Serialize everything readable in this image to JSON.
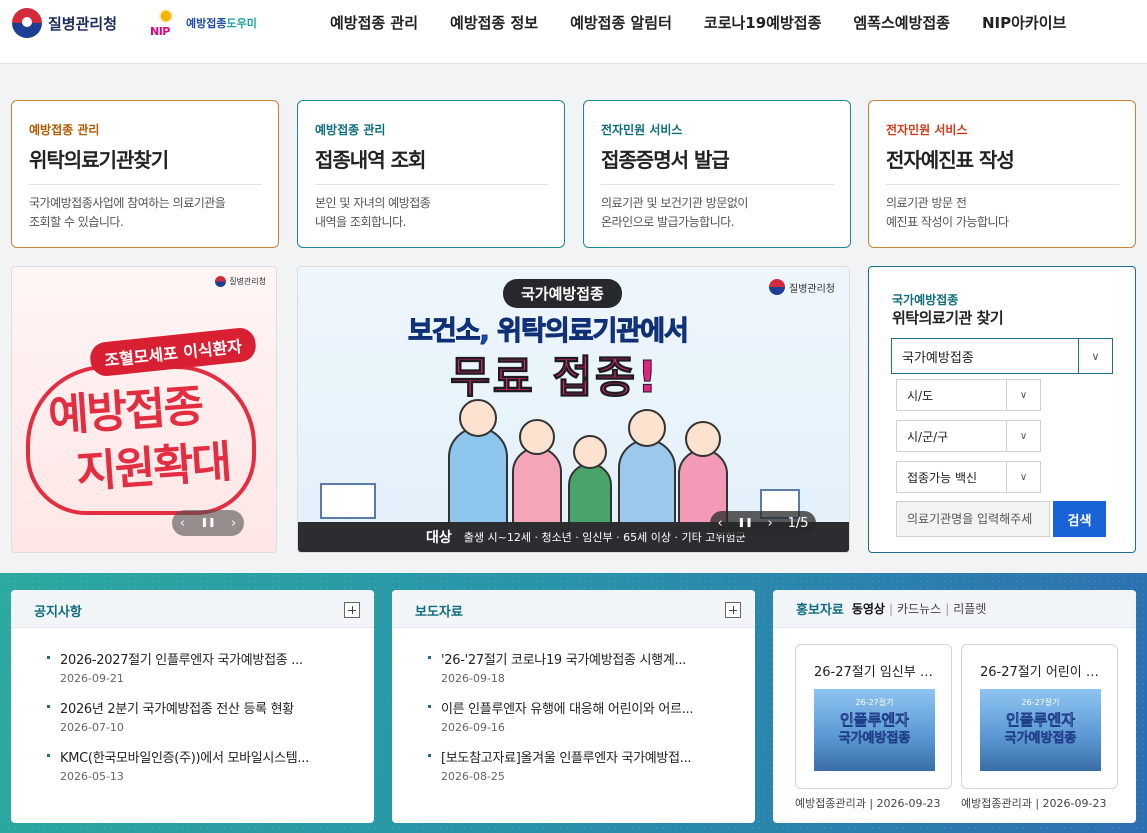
{
  "header": {
    "org_name": "질병관리청",
    "nip_letters": "NIP",
    "nip_name_a": "예방접종",
    "nip_name_b": "도우미",
    "nav": [
      "예방접종 관리",
      "예방접종 정보",
      "예방접종 알림터",
      "코로나19예방접종",
      "엠폭스예방접종",
      "NIP아카이브"
    ]
  },
  "services": [
    {
      "category": "예방접종 관리",
      "title": "위탁의료기관찾기",
      "desc1": "국가예방접종사업에 참여하는 의료기관을",
      "desc2": "조회할 수 있습니다."
    },
    {
      "category": "예방접종 관리",
      "title": "접종내역 조회",
      "desc1": "본인 및 자녀의 예방접종",
      "desc2": "내역을 조회합니다."
    },
    {
      "category": "전자민원 서비스",
      "title": "접종증명서 발급",
      "desc1": "의료기관 및 보건기관 방문없이",
      "desc2": "온라인으로 발급가능합니다."
    },
    {
      "category": "전자민원 서비스",
      "title": "전자예진표 작성",
      "desc1": "의료기관 방문 전",
      "desc2": "예진표 작성이 가능합니다"
    }
  ],
  "banner_left": {
    "org": "질병관리청",
    "pill": "조혈모세포 이식환자",
    "line1": "예방접종",
    "line2": "지원확대",
    "prev": "‹",
    "pause": "❚❚",
    "next": "›"
  },
  "banner_center": {
    "org": "질병관리청",
    "pill": "국가예방접종",
    "sub": "보건소, 위탁의료기관에서",
    "main": "무료 접종!",
    "target_label": "대상",
    "target_text": "출생 시~12세 · 청소년 · 임신부 · 65세 이상 · 기타 고위험군",
    "prev": "‹",
    "pause": "❚❚",
    "next": "›",
    "counter": "1/5"
  },
  "search": {
    "category": "국가예방접종",
    "title": "위탁의료기관 찾기",
    "type_value": "국가예방접종",
    "sido_value": "시/도",
    "sigungu_value": "시/군/구",
    "vaccine_value": "접종가능 백신",
    "input_placeholder": "의료기관명을 입력해주세",
    "button_label": "검색"
  },
  "notices": {
    "title": "공지사항",
    "items": [
      {
        "title": "2026-2027절기 인플루엔자 국가예방접종 ...",
        "date": "2026-09-21"
      },
      {
        "title": "2026년 2분기 국가예방접종 전산 등록 현황",
        "date": "2026-07-10"
      },
      {
        "title": "KMC(한국모바일인증(주))에서 모바일시스템...",
        "date": "2026-05-13"
      }
    ]
  },
  "press": {
    "title": "보도자료",
    "items": [
      {
        "title": "'26-'27절기 코로나19 국가예방접종 시행계...",
        "date": "2026-09-18"
      },
      {
        "title": "이른 인플루엔자 유행에 대응해 어린이와 어르...",
        "date": "2026-09-16"
      },
      {
        "title": "[보도참고자료]올겨울 인플루엔자 국가예방접...",
        "date": "2026-08-25"
      }
    ]
  },
  "promo": {
    "title": "홍보자료",
    "tabs": [
      "동영상",
      "카드뉴스",
      "리플렛"
    ],
    "separator": "|",
    "videos": [
      {
        "title": "26-27절기 임신부 인...",
        "thumb_top": "26-27절기",
        "thumb_line1": "인플루엔자",
        "thumb_line2": "국가예방접종",
        "meta": "예방접종관리과 | 2026-09-23"
      },
      {
        "title": "26-27절기 어린이 인...",
        "thumb_top": "26-27절기",
        "thumb_line1": "인플루엔자",
        "thumb_line2": "국가예방접종",
        "meta": "예방접종관리과 | 2026-09-23"
      }
    ]
  },
  "colors": {
    "brand_teal": "#0e6d7d",
    "accent_blue": "#1a63d6",
    "accent_pink": "#e02380",
    "accent_red": "#e32d40"
  }
}
